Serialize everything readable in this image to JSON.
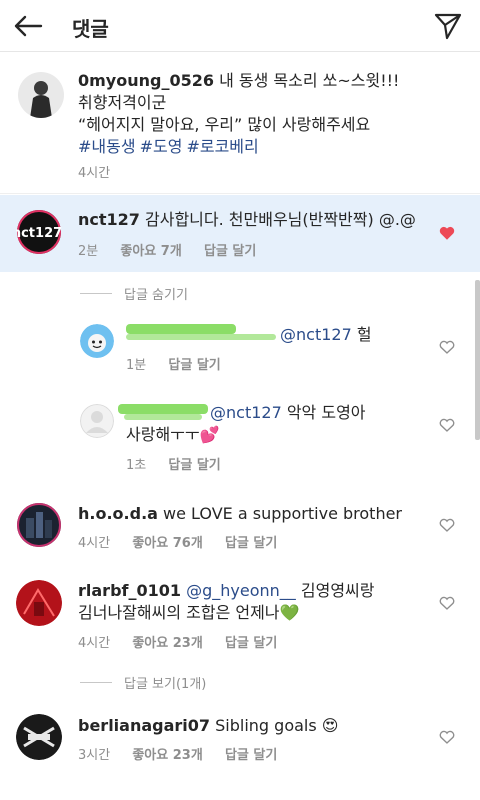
{
  "header": {
    "title": "댓글",
    "back_icon": "arrow-left-icon",
    "send_icon": "paper-plane-icon"
  },
  "colors": {
    "highlight": "#e6f0fb",
    "liked": "#ed4956",
    "link": "#2b4c8a",
    "muted": "#8e8e8e"
  },
  "caption": {
    "username": "0myoung_0526",
    "line1": " 내 동생 목소리 쏘~스윗!!!",
    "line2": "취향저격이군",
    "line3": "“헤어지지 말아요, 우리” 많이 사랑해주세요",
    "hashtags": [
      "#내동생",
      "#도영",
      "#로코베리"
    ],
    "time": "4시간"
  },
  "comments": [
    {
      "username": "nct127",
      "text": " 감사합니다. 천만배우님(반짝반짝) @.@",
      "avatar_text": "nct127",
      "time": "2분",
      "likes": "좋아요 7개",
      "reply": "답글 달기",
      "liked": true
    },
    {
      "username": "h.o.o.d.a",
      "text": " we LOVE a supportive brother",
      "time": "4시간",
      "likes": "좋아요 76개",
      "reply": "답글 달기"
    },
    {
      "username": "rlarbf_0101",
      "mention": "@g_hyeonn__",
      "text_line1": " 김영영씨랑",
      "text_line2": "김너나잘해씨의 조합은 언제나💚",
      "time": "4시간",
      "likes": "좋아요 23개",
      "reply": "답글 달기"
    },
    {
      "username": "berlianagari07",
      "text": " Sibling goals 😍",
      "time": "3시간",
      "likes": "좋아요 23개",
      "reply": "답글 달기"
    }
  ],
  "hide_replies": "답글 숨기기",
  "view_replies": "답글 보기(1개)",
  "replies": [
    {
      "mention": "@nct127",
      "text": " 헐",
      "time": "1분",
      "reply": "답글 달기"
    },
    {
      "mention": "@nct127",
      "text_line1": " 악악 도영아",
      "text_line2": "사랑해ㅜㅜ💕",
      "time": "1초",
      "reply": "답글 달기"
    }
  ]
}
